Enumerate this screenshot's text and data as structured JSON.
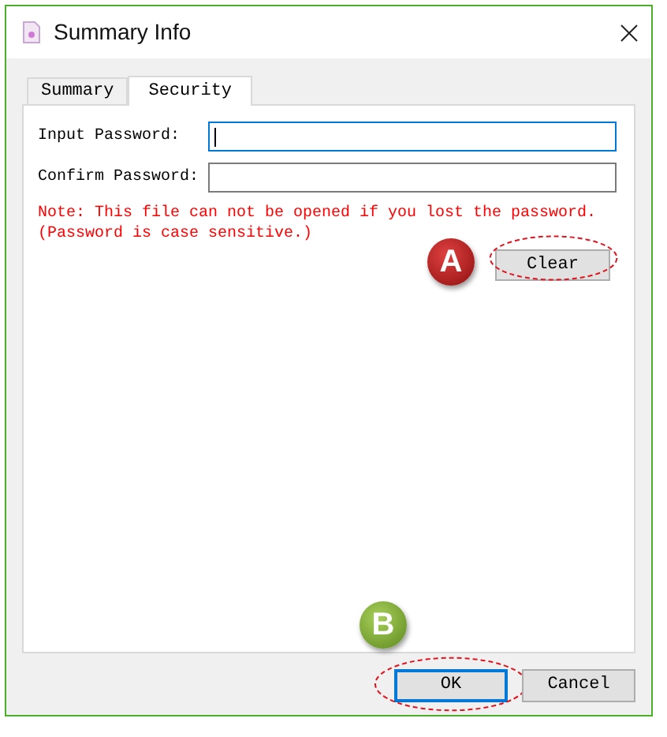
{
  "window": {
    "title": "Summary Info"
  },
  "tabs": [
    {
      "label": "Summary",
      "selected": false
    },
    {
      "label": "Security",
      "selected": true
    }
  ],
  "fields": [
    {
      "label": "Input Password:",
      "focused": true
    },
    {
      "label": "Confirm Password:",
      "focused": false
    }
  ],
  "note": [
    "Note: This file can not be opened if you lost the password.",
    "(Password is case sensitive.)"
  ],
  "clear_button": {
    "label": "Clear",
    "marker": "A"
  },
  "buttons": [
    {
      "label": "OK",
      "default": true,
      "marker": "B"
    },
    {
      "label": "Cancel",
      "default": false
    }
  ]
}
